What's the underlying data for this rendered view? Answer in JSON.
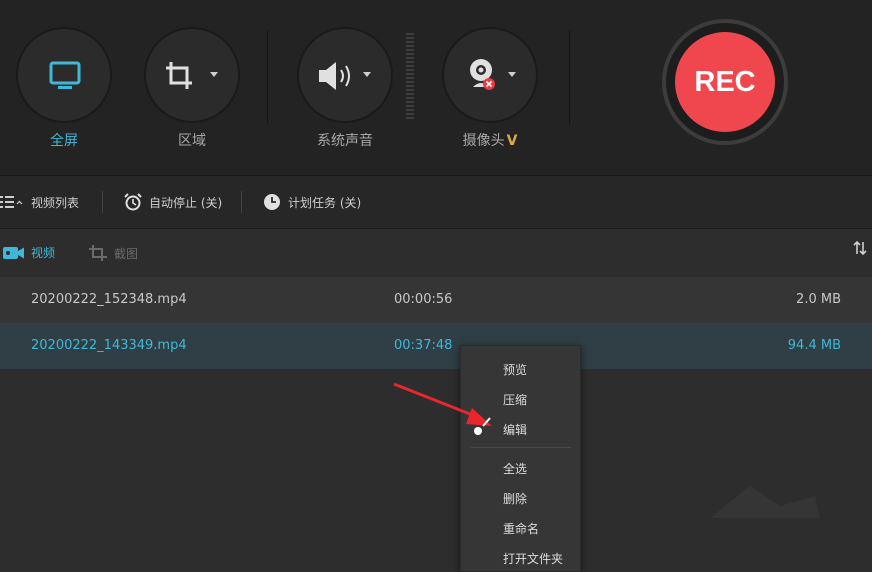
{
  "toolbar": {
    "fullscreen_label": "全屏",
    "region_label": "区域",
    "system_audio_label": "系统声音",
    "webcam_label": "摄像头",
    "webcam_badge": "V",
    "rec_label": "REC"
  },
  "subbar": {
    "video_list_label": "视频列表",
    "auto_stop_label": "自动停止 (关)",
    "schedule_label": "计划任务 (关)"
  },
  "tabs": {
    "video_label": "视频",
    "screenshot_label": "截图"
  },
  "files": [
    {
      "name": "20200222_152348.mp4",
      "duration": "00:00:56",
      "size": "2.0 MB"
    },
    {
      "name": "20200222_143349.mp4",
      "duration": "00:37:48",
      "size": "94.4 MB"
    }
  ],
  "context_menu": {
    "items": [
      "预览",
      "压缩",
      "编辑",
      "全选",
      "删除",
      "重命名",
      "打开文件夹"
    ]
  },
  "colors": {
    "accent": "#3fb8d8",
    "rec": "#ef474d",
    "badge": "#d9a94a",
    "annotation_arrow": "#e8262c"
  },
  "icons": {
    "fullscreen": "monitor-icon",
    "region": "crop-icon",
    "audio": "speaker-icon",
    "webcam": "webcam-icon",
    "list": "list-icon",
    "auto_stop": "alarm-clock-icon",
    "schedule": "clock-icon",
    "video_tab": "video-camera-icon",
    "screenshot_tab": "crop-icon",
    "sort": "sort-icon"
  }
}
